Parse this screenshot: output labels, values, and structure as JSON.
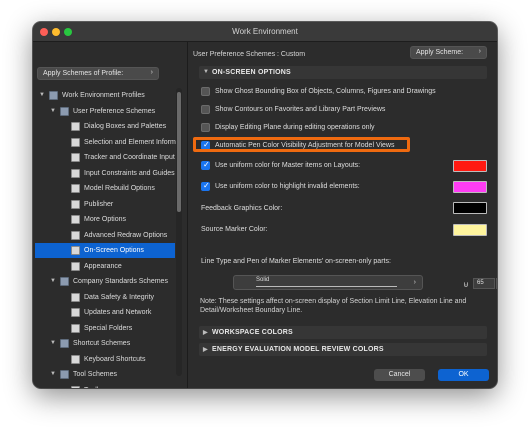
{
  "window": {
    "title": "Work Environment"
  },
  "left": {
    "apply_profile_label": "Apply Schemes of Profile:",
    "tree": [
      {
        "label": "Work Environment Profiles",
        "level": 0,
        "expanded": true,
        "icon": "folder-icon"
      },
      {
        "label": "User Preference Schemes",
        "level": 1,
        "expanded": true,
        "icon": "folder-icon"
      },
      {
        "label": "Dialog Boxes and Palettes",
        "level": 2,
        "icon": "page-icon"
      },
      {
        "label": "Selection and Element Informa",
        "level": 2,
        "icon": "page-icon"
      },
      {
        "label": "Tracker and Coordinate Input",
        "level": 2,
        "icon": "page-icon"
      },
      {
        "label": "Input Constraints and Guides",
        "level": 2,
        "icon": "page-icon"
      },
      {
        "label": "Model Rebuild Options",
        "level": 2,
        "icon": "page-icon"
      },
      {
        "label": "Publisher",
        "level": 2,
        "icon": "page-icon"
      },
      {
        "label": "More Options",
        "level": 2,
        "icon": "page-icon"
      },
      {
        "label": "Advanced Redraw Options",
        "level": 2,
        "icon": "page-icon"
      },
      {
        "label": "On-Screen Options",
        "level": 2,
        "icon": "page-icon",
        "selected": true
      },
      {
        "label": "Appearance",
        "level": 2,
        "icon": "page-icon"
      },
      {
        "label": "Company Standards Schemes",
        "level": 1,
        "expanded": true,
        "icon": "folder-icon"
      },
      {
        "label": "Data Safety & Integrity",
        "level": 2,
        "icon": "page-icon"
      },
      {
        "label": "Updates and Network",
        "level": 2,
        "icon": "page-icon"
      },
      {
        "label": "Special Folders",
        "level": 2,
        "icon": "page-icon"
      },
      {
        "label": "Shortcut Schemes",
        "level": 1,
        "expanded": true,
        "icon": "folder-icon"
      },
      {
        "label": "Keyboard Shortcuts",
        "level": 2,
        "icon": "page-icon"
      },
      {
        "label": "Tool Schemes",
        "level": 1,
        "expanded": true,
        "icon": "folder-icon"
      },
      {
        "label": "Toolbox",
        "level": 2,
        "icon": "page-icon"
      }
    ]
  },
  "right": {
    "scheme_label": "User Preference Schemes : Custom",
    "apply_scheme_label": "Apply Scheme:",
    "onscreen_header": "ON-SCREEN OPTIONS",
    "options": [
      {
        "label": "Show Ghost Bounding Box of Objects, Columns, Figures and Drawings",
        "checked": false
      },
      {
        "label": "Show Contours on Favorites and Library Part Previews",
        "checked": false
      },
      {
        "label": "Display Editing Plane during editing operations only",
        "checked": false
      },
      {
        "label": "Automatic Pen Color Visibility Adjustment for Model Views",
        "checked": true
      },
      {
        "label": "Use uniform color for Master items on Layouts:",
        "checked": true
      },
      {
        "label": "Use uniform color to highlight invalid elements:",
        "checked": true
      }
    ],
    "colors": {
      "master_items": "#ff1a12",
      "invalid_elements": "#ff3df4",
      "feedback_graphics": "#000000",
      "source_marker": "#fff59e",
      "accent": "#0d63d1",
      "highlight": "#ef6a10"
    },
    "feedback_label": "Feedback Graphics Color:",
    "source_marker_label": "Source Marker Color:",
    "marker_parts_label": "Line Type and Pen of Marker Elements' on-screen-only parts:",
    "line_type": "Solid",
    "pen_number": "65",
    "note": "Note: These settings affect on-screen display of Section Limit Line, Elevation Line and Detail/Worksheet Boundary Line.",
    "workspace_colors_header": "WORKSPACE COLORS",
    "energy_header": "ENERGY EVALUATION MODEL REVIEW COLORS",
    "cancel_label": "Cancel",
    "ok_label": "OK"
  }
}
